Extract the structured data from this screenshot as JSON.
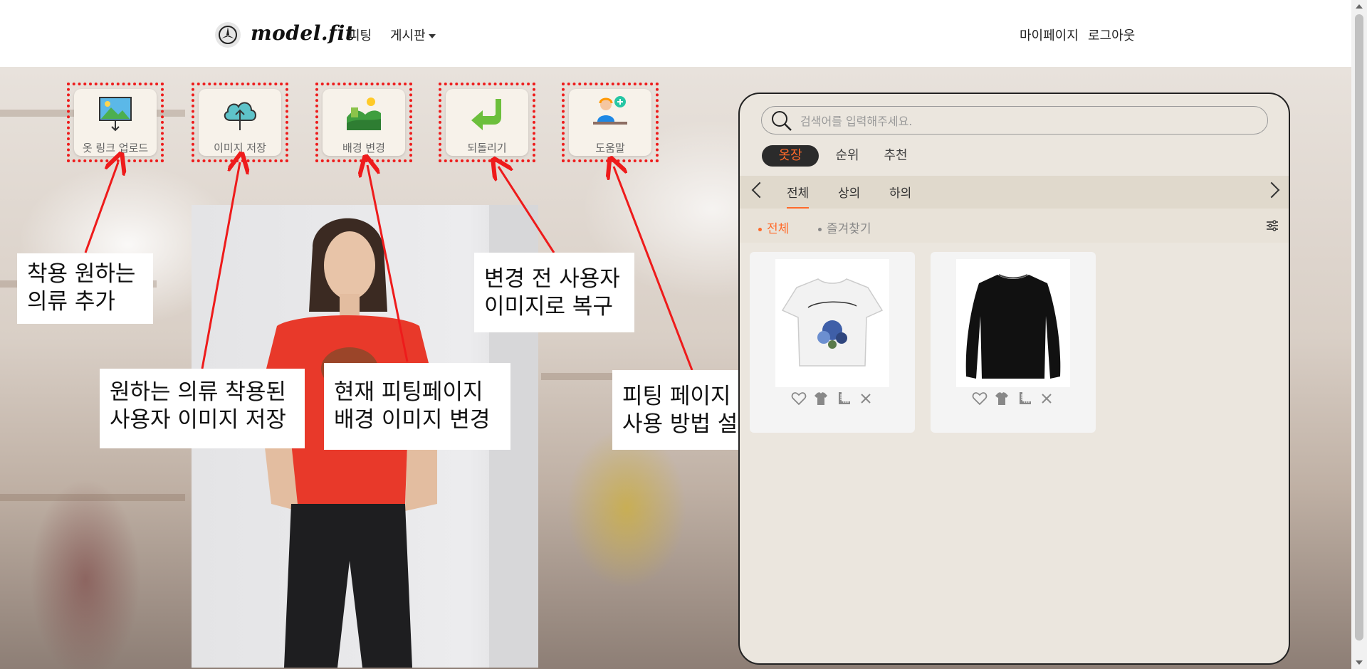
{
  "nav": {
    "brand": "model.fit",
    "links": [
      "피팅",
      "게시판"
    ],
    "right_links": [
      "마이페이지",
      "로그아웃"
    ]
  },
  "tools": [
    {
      "label": "옷 링크 업로드",
      "icon": "image-upload-icon"
    },
    {
      "label": "이미지 저장",
      "icon": "cloud-upload-icon"
    },
    {
      "label": "배경 변경",
      "icon": "landscape-icon"
    },
    {
      "label": "되돌리기",
      "icon": "undo-arrow-icon"
    },
    {
      "label": "도움말",
      "icon": "help-desk-icon"
    }
  ],
  "callouts": [
    {
      "line1": "착용 원하는",
      "line2": "의류 추가"
    },
    {
      "line1": "원하는 의류 착용된",
      "line2": "사용자 이미지 저장"
    },
    {
      "line1": "현재 피팅페이지",
      "line2": "배경 이미지 변경"
    },
    {
      "line1": "변경 전 사용자",
      "line2": "이미지로 복구"
    },
    {
      "line1": "피팅 페이지",
      "line2": "사용 방법 설명"
    }
  ],
  "closet": {
    "search_placeholder": "검색어를 입력해주세요.",
    "pills": [
      "옷장",
      "순위",
      "추천"
    ],
    "categories": [
      "전체",
      "상의",
      "하의"
    ],
    "filters": [
      "전체",
      "즐겨찾기"
    ],
    "items": [
      {
        "type": "white-graphic-tshirt"
      },
      {
        "type": "black-sweater"
      }
    ]
  },
  "colors": {
    "accent": "#ff6a2a",
    "annotation_red": "#ee1b1b",
    "panel_bg": "#ebe6de"
  }
}
